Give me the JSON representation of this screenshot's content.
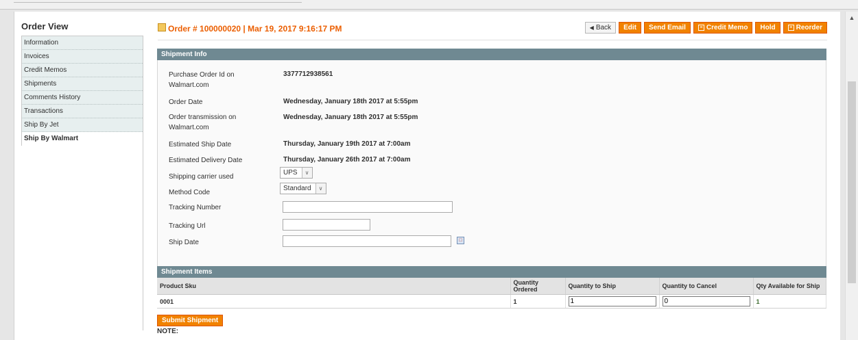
{
  "sidebar": {
    "title": "Order View",
    "items": [
      {
        "label": "Information"
      },
      {
        "label": "Invoices"
      },
      {
        "label": "Credit Memos"
      },
      {
        "label": "Shipments"
      },
      {
        "label": "Comments History"
      },
      {
        "label": "Transactions"
      },
      {
        "label": "Ship By Jet"
      },
      {
        "label": "Ship By Walmart",
        "active": true
      }
    ]
  },
  "header": {
    "title": "Order # 100000020 | Mar 19, 2017 9:16:17 PM",
    "buttons": {
      "back": "Back",
      "edit": "Edit",
      "send_email": "Send Email",
      "credit_memo": "Credit Memo",
      "hold": "Hold",
      "reorder": "Reorder"
    }
  },
  "shipment_info": {
    "heading": "Shipment Info",
    "purchase_order_label": "Purchase Order Id on Walmart.com",
    "purchase_order_value": "3377712938561",
    "order_date_label": "Order Date",
    "order_date_value": "Wednesday, January 18th 2017 at 5:55pm",
    "transmission_label": "Order transmission on Walmart.com",
    "transmission_value": "Wednesday, January 18th 2017 at 5:55pm",
    "est_ship_label": "Estimated Ship Date",
    "est_ship_value": "Thursday, January 19th 2017 at 7:00am",
    "est_delivery_label": "Estimated Delivery Date",
    "est_delivery_value": "Thursday, January 26th 2017 at 7:00am",
    "carrier_label": "Shipping carrier used",
    "carrier_value": "UPS",
    "method_label": "Method Code",
    "method_value": "Standard",
    "tracking_number_label": "Tracking Number",
    "tracking_number_value": "",
    "tracking_url_label": "Tracking Url",
    "tracking_url_value": "",
    "ship_date_label": "Ship Date",
    "ship_date_value": ""
  },
  "shipment_items": {
    "heading": "Shipment Items",
    "columns": [
      "Product Sku",
      "Quantity Ordered",
      "Quantity to Ship",
      "Quantity to Cancel",
      "Qty Available for Ship"
    ],
    "rows": [
      {
        "sku": "0001",
        "qty_ordered": "1",
        "qty_to_ship": "1",
        "qty_to_cancel": "0",
        "qty_available": "1"
      }
    ]
  },
  "submit_label": "Submit Shipment",
  "note_label": "NOTE:",
  "colors": {
    "accent": "#eb5e00",
    "button": "#f18200",
    "section_header": "#6f8992",
    "available_qty": "#3d6b2f"
  },
  "icons": [
    "order-doc-icon",
    "back-arrow-icon",
    "credit-memo-icon",
    "reorder-icon",
    "calendar-icon",
    "scroll-up-icon"
  ]
}
